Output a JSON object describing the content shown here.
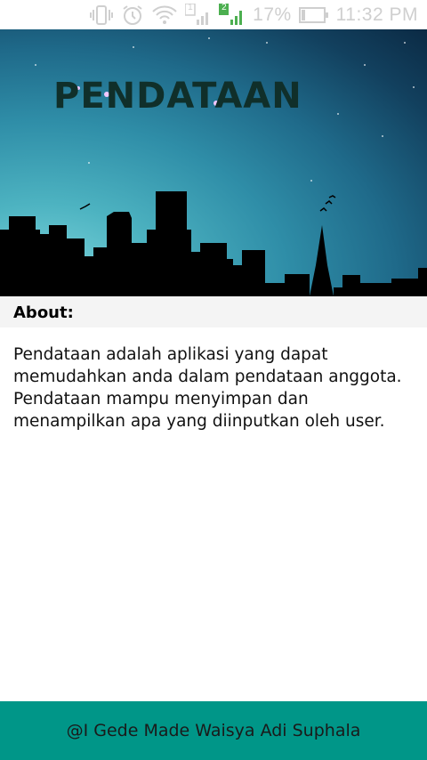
{
  "status_bar": {
    "battery_percent": "17%",
    "time": "11:32 PM",
    "sim1_label": "1",
    "sim2_label": "2",
    "icons": [
      "vibrate-icon",
      "alarm-icon",
      "wifi-icon",
      "signal-sim1-icon",
      "signal-sim2-icon",
      "battery-icon"
    ],
    "sim2_color": "#4caf50"
  },
  "banner": {
    "title": "PENDATAAN"
  },
  "about": {
    "heading": "About:",
    "body": "Pendataan adalah aplikasi yang dapat memudahkan anda dalam pendataan anggota. Pendataan mampu menyimpan dan menampilkan apa yang diinputkan oleh user."
  },
  "footer": {
    "credit": "@I Gede Made Waisya Adi Suphala",
    "background_color": "#009688"
  }
}
